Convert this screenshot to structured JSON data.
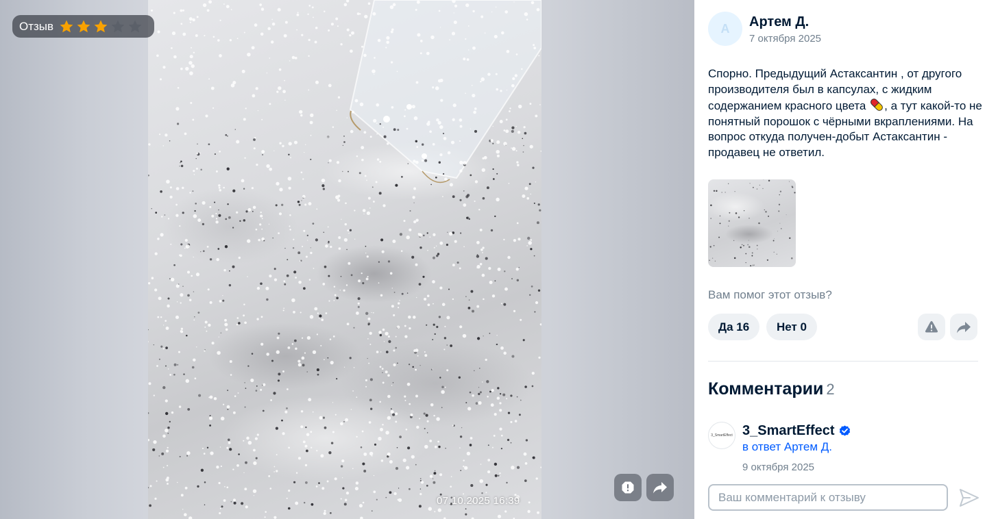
{
  "viewer": {
    "rating_label": "Отзыв",
    "rating": 3,
    "rating_max": 5,
    "timestamp": "07.10.2025 16:39",
    "star_filled_color": "#f9a200",
    "star_empty_color": "#5b6069",
    "actions": [
      {
        "icon": "report-icon"
      },
      {
        "icon": "share-icon"
      }
    ]
  },
  "review": {
    "author_initial": "А",
    "author_name": "Артем Д.",
    "date": "7 октября 2025",
    "text_before_emoji": "Спорно. Предыдущий Астаксантин , от другого производителя был в капсулах, с жидким содержанием красного цвета ",
    "emoji_icon": "pill-icon",
    "text_after_emoji": ", а тут какой-то не понятный порошок с чёрными вкраплениями. На вопрос откуда получен-добыт Астаксантин - продавец не ответил.",
    "helpful_question": "Вам помог этот отзыв?",
    "yes_label": "Да 16",
    "no_label": "Нет 0"
  },
  "comments": {
    "title": "Комментарии",
    "count": "2",
    "items": [
      {
        "avatar_text": "3_SmartEffect",
        "author": "3_SmartEffect",
        "verified": true,
        "reply_to": "в ответ Артем Д.",
        "date": "9 октября 2025"
      }
    ],
    "input_placeholder": "Ваш комментарий к отзыву",
    "accent_color": "#005bff"
  }
}
